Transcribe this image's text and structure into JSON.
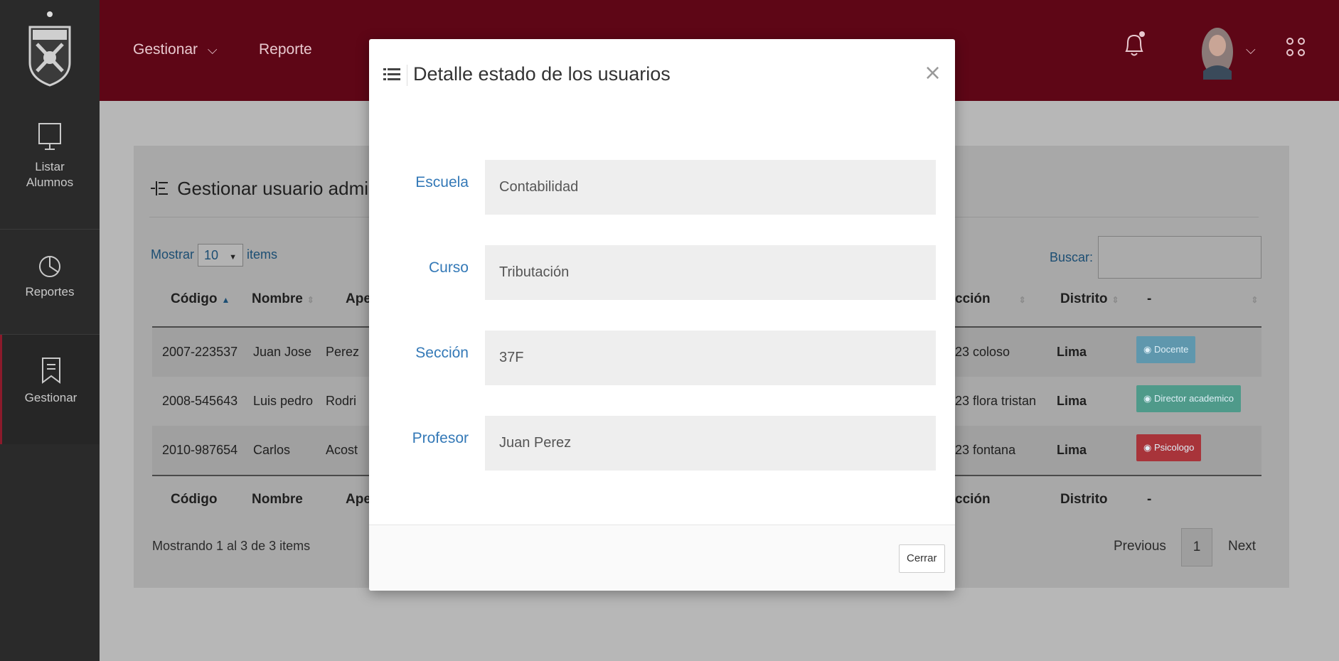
{
  "sidebar": {
    "items": [
      {
        "label_1": "Listar",
        "label_2": "Alumnos",
        "icon": "monitor-icon"
      },
      {
        "label": "Reportes",
        "icon": "pie-chart-icon"
      },
      {
        "label": "Gestionar",
        "icon": "bookmark-icon"
      }
    ]
  },
  "topbar": {
    "nav": {
      "gestionar": "Gestionar",
      "reporte": "Reporte"
    },
    "chevron": "⌵"
  },
  "panel": {
    "title": "Gestionar usuario admin",
    "mostrar_label": "Mostrar",
    "page_size": "10",
    "items_label": "items",
    "buscar_label": "Buscar:",
    "columns_left": [
      "Código",
      "Nombre",
      "Ape"
    ],
    "columns_right": [
      "cción",
      "Distrito",
      "-"
    ],
    "rows": [
      {
        "codigo": "2007-223537",
        "nombre": "Juan Jose",
        "apellido": "Perez",
        "direccion": "23 coloso",
        "distrito": "Lima",
        "rol": "Docente"
      },
      {
        "codigo": "2008-545643",
        "nombre": "Luis pedro",
        "apellido": "Rodri",
        "direccion": "23 flora tristan",
        "distrito": "Lima",
        "rol": "Director academico"
      },
      {
        "codigo": "2010-987654",
        "nombre": "Carlos",
        "apellido": "Acost",
        "direccion": "23 fontana",
        "distrito": "Lima",
        "rol": "Psicologo"
      }
    ],
    "info": "Mostrando 1 al 3 de 3 items",
    "pager": {
      "previous": "Previous",
      "page": "1",
      "next": "Next"
    }
  },
  "modal": {
    "title": "Detalle estado de los usuarios",
    "close_glyph": "×",
    "fields": [
      {
        "label": "Escuela",
        "value": "Contabilidad"
      },
      {
        "label": "Curso",
        "value": "Tributación"
      },
      {
        "label": "Sección",
        "value": "37F"
      },
      {
        "label": "Profesor",
        "value": "Juan Perez"
      }
    ],
    "close_button": "Cerrar"
  },
  "colors": {
    "topbar": "#5e0616",
    "sidebar": "#2a2a2a",
    "label_blue": "#3479b7",
    "badge_docente": "#5f97ad",
    "badge_director": "#4f9a8a",
    "badge_psicologo": "#a8343a"
  }
}
